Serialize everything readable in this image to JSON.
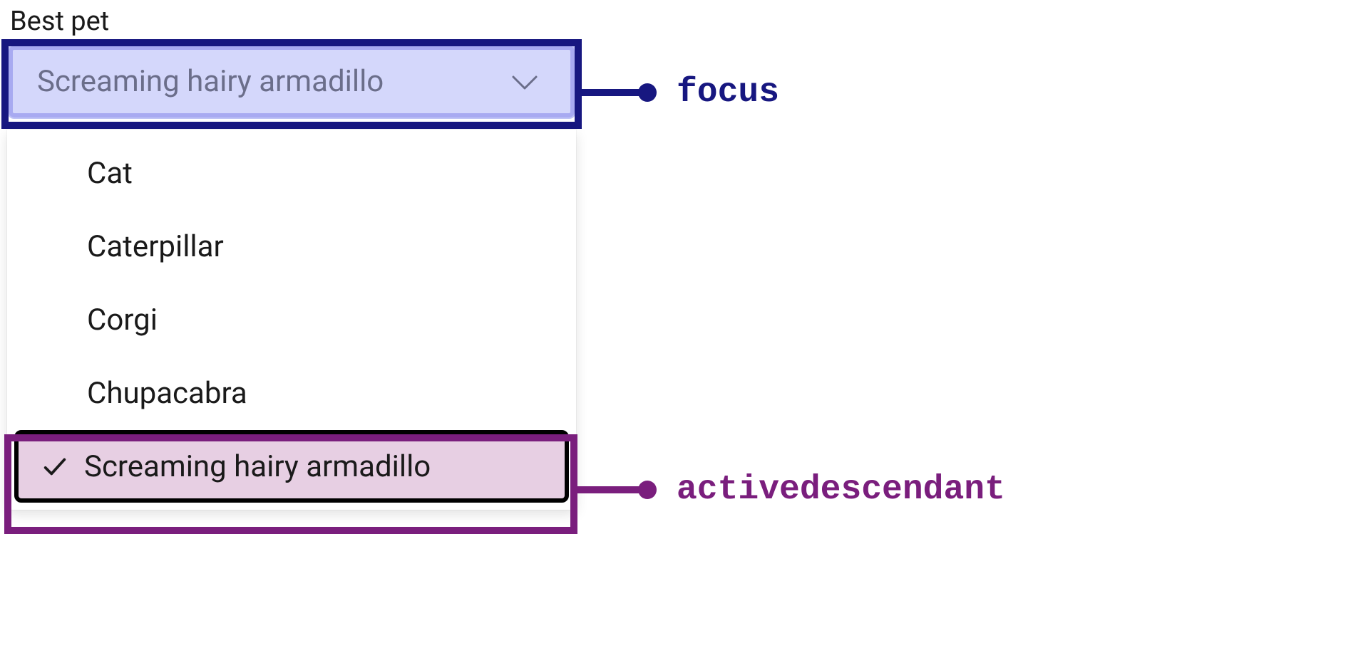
{
  "colors": {
    "focus_outline": "#171780",
    "active_outline": "#7a1e7d",
    "combobox_bg": "#d4d7fb",
    "active_option_bg": "#e7cfe3"
  },
  "field": {
    "label": "Best pet"
  },
  "combobox": {
    "selected_value": "Screaming hairy armadillo"
  },
  "options": [
    {
      "label": "Cat",
      "selected": false,
      "active": false
    },
    {
      "label": "Caterpillar",
      "selected": false,
      "active": false
    },
    {
      "label": "Corgi",
      "selected": false,
      "active": false
    },
    {
      "label": "Chupacabra",
      "selected": false,
      "active": false
    },
    {
      "label": "Screaming hairy armadillo",
      "selected": true,
      "active": true
    }
  ],
  "annotations": {
    "focus_label": "focus",
    "active_label": "activedescendant"
  }
}
